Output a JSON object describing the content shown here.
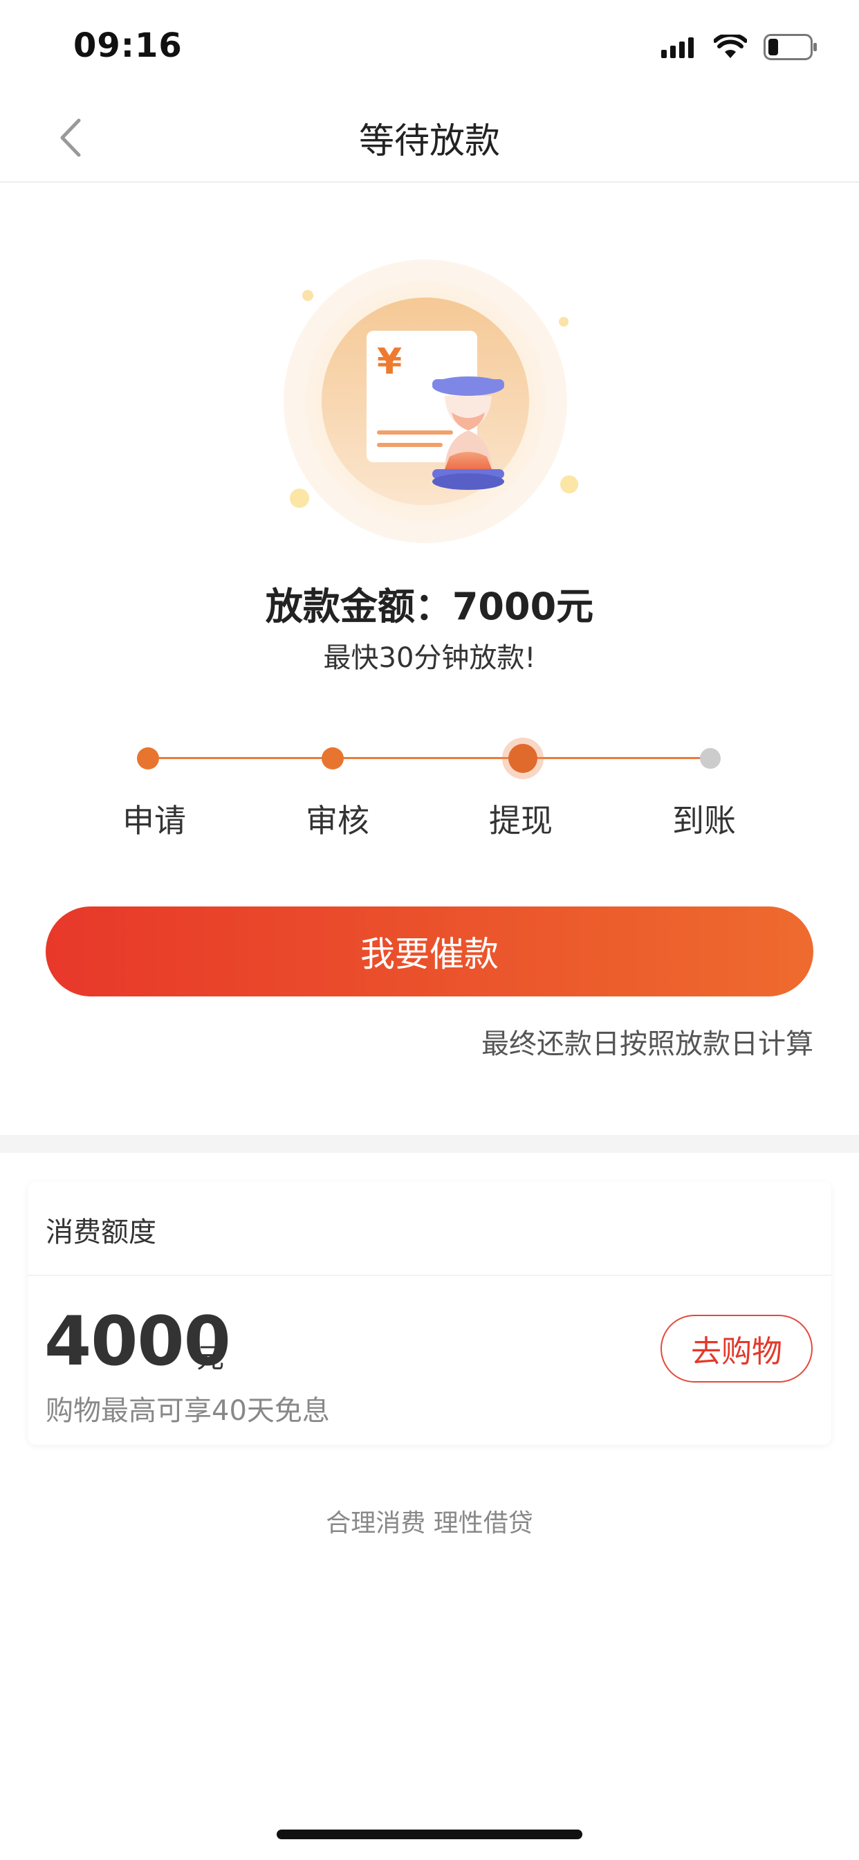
{
  "status_bar": {
    "time": "09:16",
    "icons": [
      "signal-icon",
      "wifi-icon",
      "battery-icon"
    ]
  },
  "nav": {
    "title": "等待放款",
    "back_icon": "chevron-left-icon"
  },
  "illustration": {
    "icon": "hourglass-document-icon",
    "currency_symbol": "¥"
  },
  "loan": {
    "amount_text": "放款金额：7000元",
    "subtitle": "最快30分钟放款!"
  },
  "steps": [
    {
      "label": "申请",
      "state": "done"
    },
    {
      "label": "审核",
      "state": "done"
    },
    {
      "label": "提现",
      "state": "current"
    },
    {
      "label": "到账",
      "state": "pending"
    }
  ],
  "cta": {
    "label": "我要催款"
  },
  "note": "最终还款日按照放款日计算",
  "credit_card": {
    "title": "消费额度",
    "amount": "4000",
    "unit": "元",
    "description": "购物最高可享40天免息",
    "shop_button": "去购物"
  },
  "footer": {
    "slogan": "合理消费 理性借贷"
  },
  "colors": {
    "accent": "#e8752f",
    "cta_start": "#e8382a",
    "cta_end": "#ee6b2e",
    "pending": "#cccccc"
  }
}
